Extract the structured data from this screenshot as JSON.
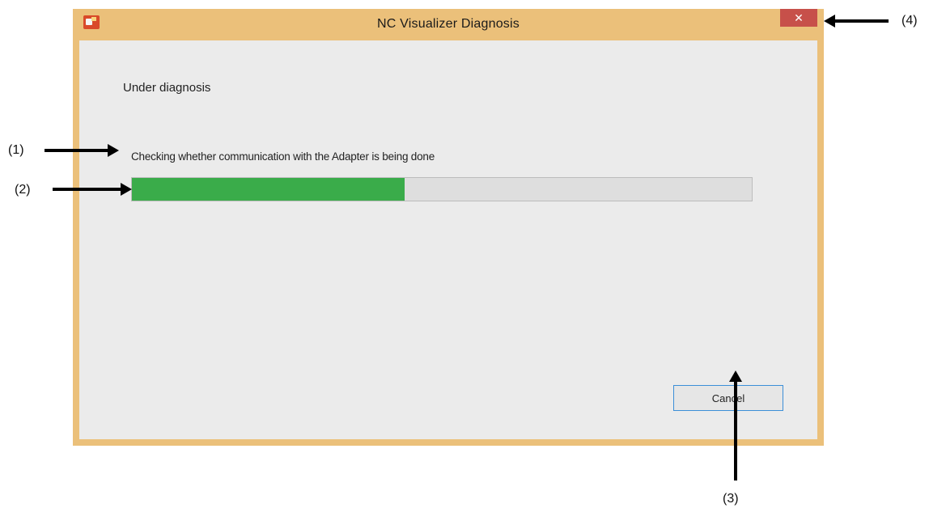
{
  "window": {
    "title": "NC Visualizer Diagnosis",
    "close_glyph": "✕"
  },
  "dialog": {
    "heading": "Under diagnosis",
    "status_text": "Checking whether communication with the Adapter is being done",
    "progress_percent": 44,
    "cancel_label": "Cancel"
  },
  "callouts": [
    {
      "label": "(1)"
    },
    {
      "label": "(2)"
    },
    {
      "label": "(3)"
    },
    {
      "label": "(4)"
    }
  ],
  "colors": {
    "frame": "#ebc07a",
    "close_button": "#c7504a",
    "progress_fill": "#3aac4a",
    "button_focus_border": "#3c8fd8"
  },
  "icons": {
    "app_icon": "app-icon",
    "close_icon": "close-icon"
  }
}
